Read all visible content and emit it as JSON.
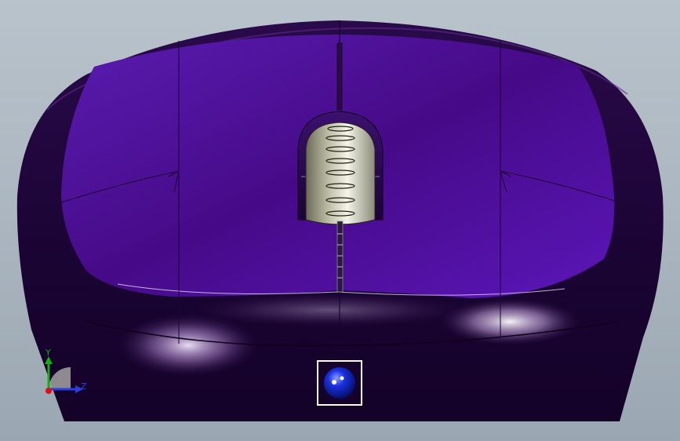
{
  "viewport": {
    "background": "#aeb8c2"
  },
  "model": {
    "body_color": "#1a0433",
    "top_color": "#4a0e8c",
    "wheel_color": "#c8c8b0"
  },
  "triad": {
    "y_label": "Y",
    "z_label": "Z",
    "y_color": "#10b010",
    "z_color": "#2a3fe0",
    "origin_color": "#e01010"
  },
  "marker": {
    "icon": "sphere-icon",
    "color": "#1020d0"
  }
}
